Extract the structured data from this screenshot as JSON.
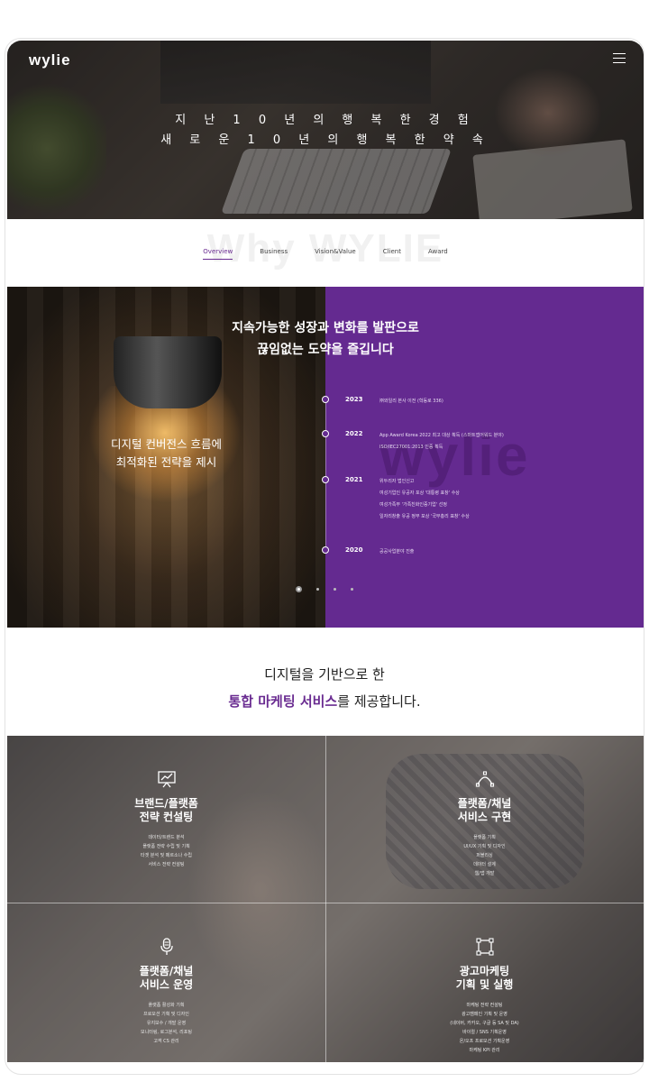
{
  "header": {
    "logo": "wylie",
    "hero_line1": "지 난 1 0 년 의 행 복 한 경 험",
    "hero_line2": "새 로 운 1 0 년 의 행 복 한 약 속"
  },
  "about": {
    "watermark": "Why WYLIE",
    "tabs": [
      "Overview",
      "Business",
      "Vision&Value",
      "Client",
      "Award"
    ],
    "active_tab": "Overview"
  },
  "timeline": {
    "title_line1": "지속가능한 성장과 변화를 발판으로",
    "title_line2": "끊임없는 도약을 즐깁니다",
    "left_caption_line1": "디지털 컨버전스 흐름에",
    "left_caption_line2": "최적화된 전략을 제시",
    "watermark": "wylie",
    "years": [
      {
        "year": "2023",
        "events": [
          "㈜와일리 본사 이전 (학동로 336)"
        ]
      },
      {
        "year": "2022",
        "events": [
          "App Award Korea 2022 최고 대상 획득 (스마트앱어워드 분야)",
          "ISO/IEC27001:2013 인증 획득"
        ]
      },
      {
        "year": "2021",
        "events": [
          "위두리자 법인신고",
          "여성기업인 유공자 포상 '대통령 표창' 수상",
          "여성가족부 '가족친화인증기업' 선정",
          "일자리창출 유공 정부 포상 '국무총리 표창' 수상"
        ]
      },
      {
        "year": "2020",
        "events": [
          "공공사업분야 진출"
        ]
      }
    ],
    "pager_count": 4,
    "pager_active": 0
  },
  "services": {
    "intro_line1": "디지털을 기반으로 한",
    "intro_highlight": "통합 마케팅 서비스",
    "intro_rest": "를 제공합니다.",
    "cells": [
      {
        "icon": "presentation-icon",
        "title_line1": "브랜드/플랫폼",
        "title_line2": "전략 컨설팅",
        "items": [
          "데이터/트렌드 분석",
          "플랫폼 전략 수립 및 기획",
          "타겟 분석 및 페르소나 수립",
          "서비스 전략 컨설팅"
        ]
      },
      {
        "icon": "bezier-pen-icon",
        "title_line1": "플랫폼/채널",
        "title_line2": "서비스 구현",
        "items": [
          "플랫폼 기획",
          "UI/UX 기획 및 디자인",
          "퍼블리싱",
          "데이터 설계",
          "웹/앱 개발"
        ]
      },
      {
        "icon": "microphone-icon",
        "title_line1": "플랫폼/채널",
        "title_line2": "서비스 운영",
        "items": [
          "플랫폼 활성화 기획",
          "프로모션 기획 및 디자인",
          "유지보수 / 개발 운영",
          "모니터링, 로그분석, 리포팅",
          "고객 CS 관리"
        ]
      },
      {
        "icon": "crop-frame-icon",
        "title_line1": "광고마케팅",
        "title_line2": "기획 및 실행",
        "items": [
          "마케팅 전략 컨설팅",
          "광고캠페인 기획 및 운영",
          "(네이버, 카카오, 구글 등 SA 및 DA)",
          "바이럴 / SNS 기획운영",
          "온/오프 프로모션 기획운영",
          "마케팅 KPI 관리"
        ]
      }
    ]
  }
}
